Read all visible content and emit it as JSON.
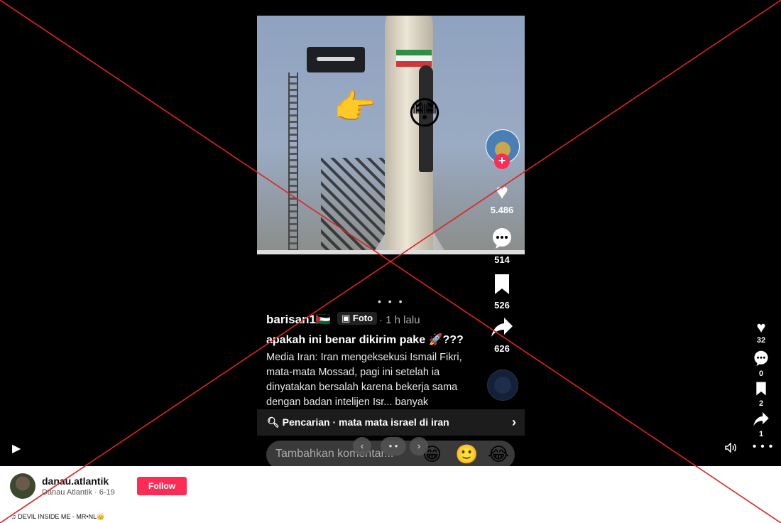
{
  "post": {
    "username": "barisan1🇵🇸",
    "tag": "Foto",
    "time": "· 1 h lalu",
    "title": "apakah ini benar dikirim pake 🚀???",
    "body": "Media Iran: Iran mengeksekusi Ismail Fikri, mata-mata Mossad, pagi ini setelah ia dinyatakan bersalah karena bekerja sama dengan badan intelijen Isr... banyak",
    "pager": "• • •"
  },
  "actions": {
    "likes": "5.486",
    "comments": "514",
    "saves": "526",
    "shares": "626"
  },
  "search": {
    "text": "Pencarian · mata mata israel di iran"
  },
  "comment_box": {
    "placeholder": "Tambahkan komentar...",
    "emojis": [
      "😁",
      "🙂",
      "😂"
    ]
  },
  "overlay_controls": {
    "prev": "‹",
    "dots": "• •",
    "next": "›"
  },
  "player_actions": {
    "likes": "32",
    "comments": "0",
    "saves": "2",
    "shares": "1"
  },
  "author": {
    "handle": "danau.atlantik",
    "display": "Danau Atlantik · 6-19",
    "follow": "Follow"
  },
  "music": "♫ DEVIL INSIDE ME - MR•NL👑",
  "colors": {
    "accent": "#fe2c55",
    "background": "#000000",
    "cross": "#e0221f"
  },
  "icons": {
    "like": "heart-icon",
    "comment": "speech-bubble-icon",
    "save": "bookmark-icon",
    "share": "share-arrow-icon",
    "play": "play-icon",
    "volume": "volume-icon",
    "more": "more-dots-icon",
    "search": "search-icon"
  }
}
